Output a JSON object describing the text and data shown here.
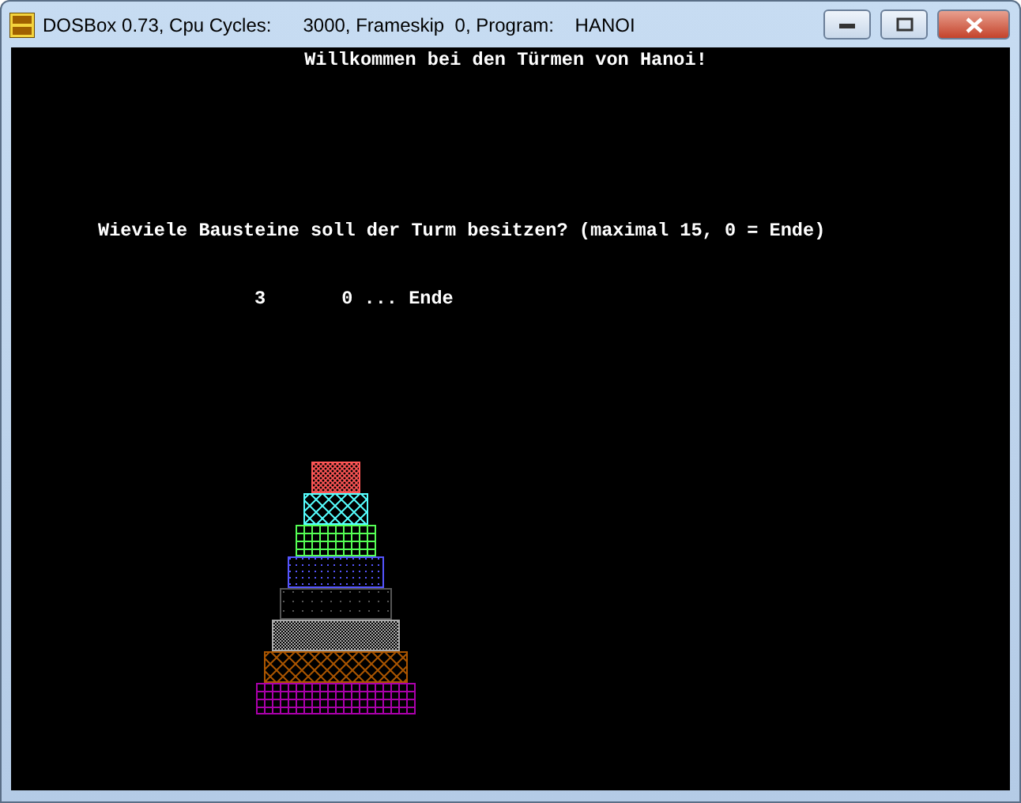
{
  "window": {
    "title": "DOSBox 0.73, Cpu Cycles:      3000, Frameskip  0, Program:    HANOI"
  },
  "screen": {
    "heading": "Willkommen bei den Türmen von Hanoi!",
    "prompt": "Wieviele Bausteine soll der Turm besitzen? (maximal 15, 0 = Ende)",
    "answer": "3",
    "hint": "0 ... Ende"
  },
  "tower": [
    {
      "kind": "crosshatch",
      "color": "#ff5555"
    },
    {
      "kind": "diamond",
      "color": "#55ffff"
    },
    {
      "kind": "grid",
      "color": "#55ff55"
    },
    {
      "kind": "dots",
      "color": "#5555ff"
    },
    {
      "kind": "sparse",
      "color": "#555555"
    },
    {
      "kind": "checker",
      "color": "#aaaaaa"
    },
    {
      "kind": "diamond",
      "color": "#aa5500"
    },
    {
      "kind": "grid",
      "color": "#aa00aa"
    }
  ]
}
